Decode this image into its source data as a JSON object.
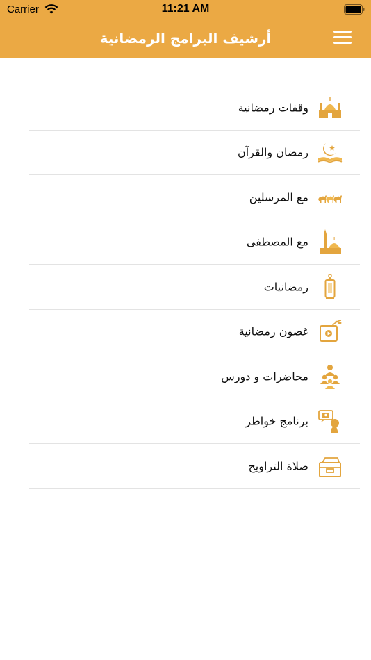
{
  "status": {
    "carrier": "Carrier",
    "time": "11:21 AM"
  },
  "header": {
    "title": "أرشيف البرامج الرمضانية",
    "menu_icon": "hamburger-menu-icon"
  },
  "colors": {
    "accent": "#eba944",
    "divider": "#e3e3e3",
    "text": "#111111"
  },
  "menu": [
    {
      "label": "وقفات رمضانية",
      "icon": "mosque-icon"
    },
    {
      "label": "رمضان والقرآن",
      "icon": "crescent-quran-icon"
    },
    {
      "label": "مع المرسلين",
      "icon": "camel-caravan-icon"
    },
    {
      "label": "مع المصطفى",
      "icon": "minaret-dome-icon"
    },
    {
      "label": "رمضانيات",
      "icon": "lantern-icon"
    },
    {
      "label": "غصون رمضانية",
      "icon": "video-branch-icon"
    },
    {
      "label": "محاضرات و دورس",
      "icon": "audience-lecture-icon"
    },
    {
      "label": "برنامج خواطر",
      "icon": "speaker-thoughts-icon"
    },
    {
      "label": "صلاة التراويح",
      "icon": "archive-box-icon"
    }
  ]
}
